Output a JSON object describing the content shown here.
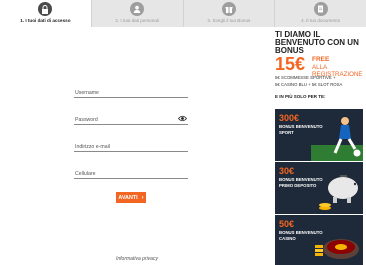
{
  "steps": [
    {
      "label": "1.  I tuoi dati di accesso",
      "icon": "lock-icon"
    },
    {
      "label": "2.  I tuoi dati personali",
      "icon": "user-icon"
    },
    {
      "label": "3.  Scegli il tuo Bonus",
      "icon": "gift-icon"
    },
    {
      "label": "4.  Il tuo documento",
      "icon": "document-icon"
    }
  ],
  "form": {
    "username_placeholder": "Username",
    "password_placeholder": "Password",
    "email_placeholder": "Indirizzo e-mail",
    "phone_placeholder": "Cellulare",
    "next_label": "AVANTI",
    "privacy_link": "Informativa privacy"
  },
  "promo": {
    "title": "TI DIAMO IL BENVENUTO CON UN BONUS",
    "amount": "15€",
    "free_line1": "FREE",
    "free_line2": "ALLA REGISTRAZIONE",
    "detail1": "5€ SCOMMESSE SPORTIVE +",
    "detail2": "5€ CASINO BLU + 5€ SLOT ROSA",
    "more_label": "E IN PIÙ SOLO PER TE:",
    "cards": [
      {
        "amount": "300€",
        "line1": "BONUS BENVENUTO",
        "line2": "SPORT"
      },
      {
        "amount": "30€",
        "line1": "BONUS BENVENUTO",
        "line2": "PRIMO DEPOSITO"
      },
      {
        "amount": "50€",
        "line1": "BONUS BENVENUTO",
        "line2": "CASINO"
      }
    ]
  },
  "colors": {
    "accent": "#f26522",
    "card_bg": "#1e2a3a"
  }
}
